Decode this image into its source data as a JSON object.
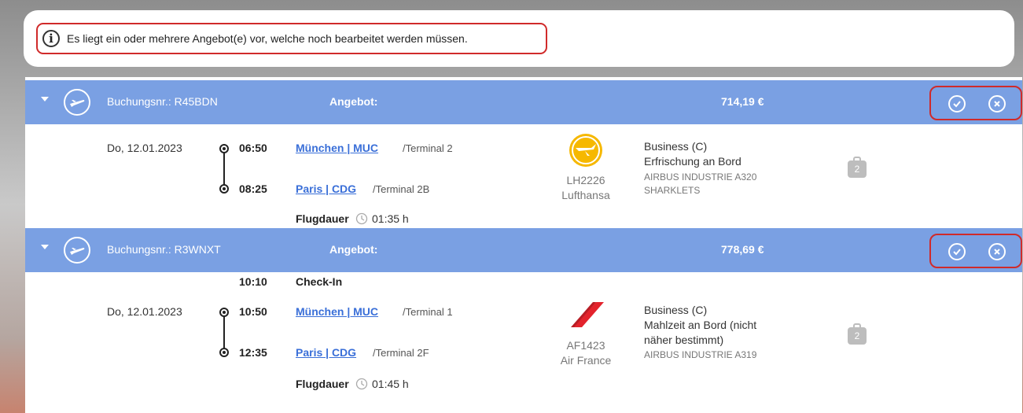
{
  "notice": {
    "text": "Es liegt ein oder mehrere Angebot(e) vor, welche noch bearbeitet werden müssen."
  },
  "offers": [
    {
      "booking": "Buchungsnr.: R45BDN",
      "offer_label": "Angebot:",
      "price": "714,19 €",
      "date": "Do, 12.01.2023",
      "dep_time": "06:50",
      "dep_city": "München | MUC",
      "dep_terminal": "/Terminal 2",
      "arr_time": "08:25",
      "arr_city": "Paris | CDG",
      "arr_terminal": "/Terminal 2B",
      "duration_label": "Flugdauer",
      "duration": "01:35 h",
      "flight_no": "LH2226",
      "airline": "Lufthansa",
      "cabin": "Business (C)",
      "meal": "Erfrischung an Bord",
      "aircraft_line1": "AIRBUS INDUSTRIE A320",
      "aircraft_line2": "SHARKLETS",
      "bag_count": "2"
    },
    {
      "booking": "Buchungsnr.: R3WNXT",
      "offer_label": "Angebot:",
      "price": "778,69 €",
      "checkin_time": "10:10",
      "checkin_label": "Check-In",
      "date": "Do, 12.01.2023",
      "dep_time": "10:50",
      "dep_city": "München | MUC",
      "dep_terminal": "/Terminal 1",
      "arr_time": "12:35",
      "arr_city": "Paris | CDG",
      "arr_terminal": "/Terminal 2F",
      "duration_label": "Flugdauer",
      "duration": "01:45 h",
      "flight_no": "AF1423",
      "airline": "Air France",
      "cabin": "Business (C)",
      "meal_line1": "Mahlzeit an Bord (nicht",
      "meal_line2": "näher bestimmt)",
      "aircraft_line1": "AIRBUS INDUSTRIE A319",
      "bag_count": "2"
    }
  ],
  "colors": {
    "bar": "#7aa0e3",
    "highlight": "#d02a2a",
    "link": "#3a6fd8",
    "lufthansa": "#f6b800",
    "airfrance": "#e3232c"
  }
}
